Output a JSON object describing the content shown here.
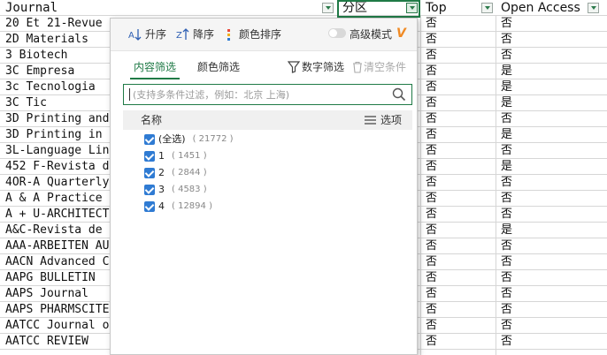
{
  "sheet": {
    "headers": [
      "Journal",
      "分区",
      "Top",
      "Open Access"
    ],
    "rows": [
      {
        "journal": "20 Et 21-Revue",
        "top": "否",
        "oa": "否"
      },
      {
        "journal": "2D Materials",
        "top": "否",
        "oa": "否"
      },
      {
        "journal": "3 Biotech",
        "top": "否",
        "oa": "否"
      },
      {
        "journal": "3C Empresa",
        "top": "否",
        "oa": "是"
      },
      {
        "journal": "3c Tecnologia",
        "top": "否",
        "oa": "是"
      },
      {
        "journal": "3C Tic",
        "top": "否",
        "oa": "是"
      },
      {
        "journal": "3D Printing and",
        "top": "否",
        "oa": "否"
      },
      {
        "journal": "3D Printing in",
        "top": "否",
        "oa": "是"
      },
      {
        "journal": "3L-Language Lin",
        "top": "否",
        "oa": "否"
      },
      {
        "journal": "452 F-Revista d",
        "top": "否",
        "oa": "是"
      },
      {
        "journal": "4OR-A Quarterly",
        "top": "否",
        "oa": "否"
      },
      {
        "journal": "A & A Practice",
        "top": "否",
        "oa": "否"
      },
      {
        "journal": "A + U-ARCHITECT",
        "top": "否",
        "oa": "否"
      },
      {
        "journal": "A&C-Revista de",
        "top": "否",
        "oa": "是"
      },
      {
        "journal": "AAA-ARBEITEN AU",
        "top": "否",
        "oa": "否"
      },
      {
        "journal": "AACN Advanced C",
        "top": "否",
        "oa": "否"
      },
      {
        "journal": "AAPG BULLETIN",
        "top": "否",
        "oa": "否"
      },
      {
        "journal": "AAPS Journal",
        "top": "否",
        "oa": "否"
      },
      {
        "journal": "AAPS PHARMSCITE",
        "top": "否",
        "oa": "否"
      },
      {
        "journal": "AATCC Journal o",
        "top": "否",
        "oa": "否"
      },
      {
        "journal": "AATCC REVIEW",
        "top": "否",
        "oa": "否"
      }
    ]
  },
  "panel": {
    "sort_asc": "升序",
    "sort_desc": "降序",
    "sort_color": "颜色排序",
    "advanced": "高级模式",
    "tab_content": "内容筛选",
    "tab_color": "颜色筛选",
    "number_filter": "数字筛选",
    "clear": "清空条件",
    "search_placeholder": "(支持多条件过滤，例如：北京 上海)",
    "list_name": "名称",
    "options": "选项",
    "items": [
      {
        "label": "(全选)",
        "count": "( 21772 )"
      },
      {
        "label": "1",
        "count": "( 1451 )"
      },
      {
        "label": "2",
        "count": "( 2844 )"
      },
      {
        "label": "3",
        "count": "( 4583 )"
      },
      {
        "label": "4",
        "count": "( 12894 )"
      }
    ]
  },
  "colors": {
    "accent": "#1f7a46",
    "checkbox": "#2f7bd3",
    "vip": "#f08a24"
  }
}
